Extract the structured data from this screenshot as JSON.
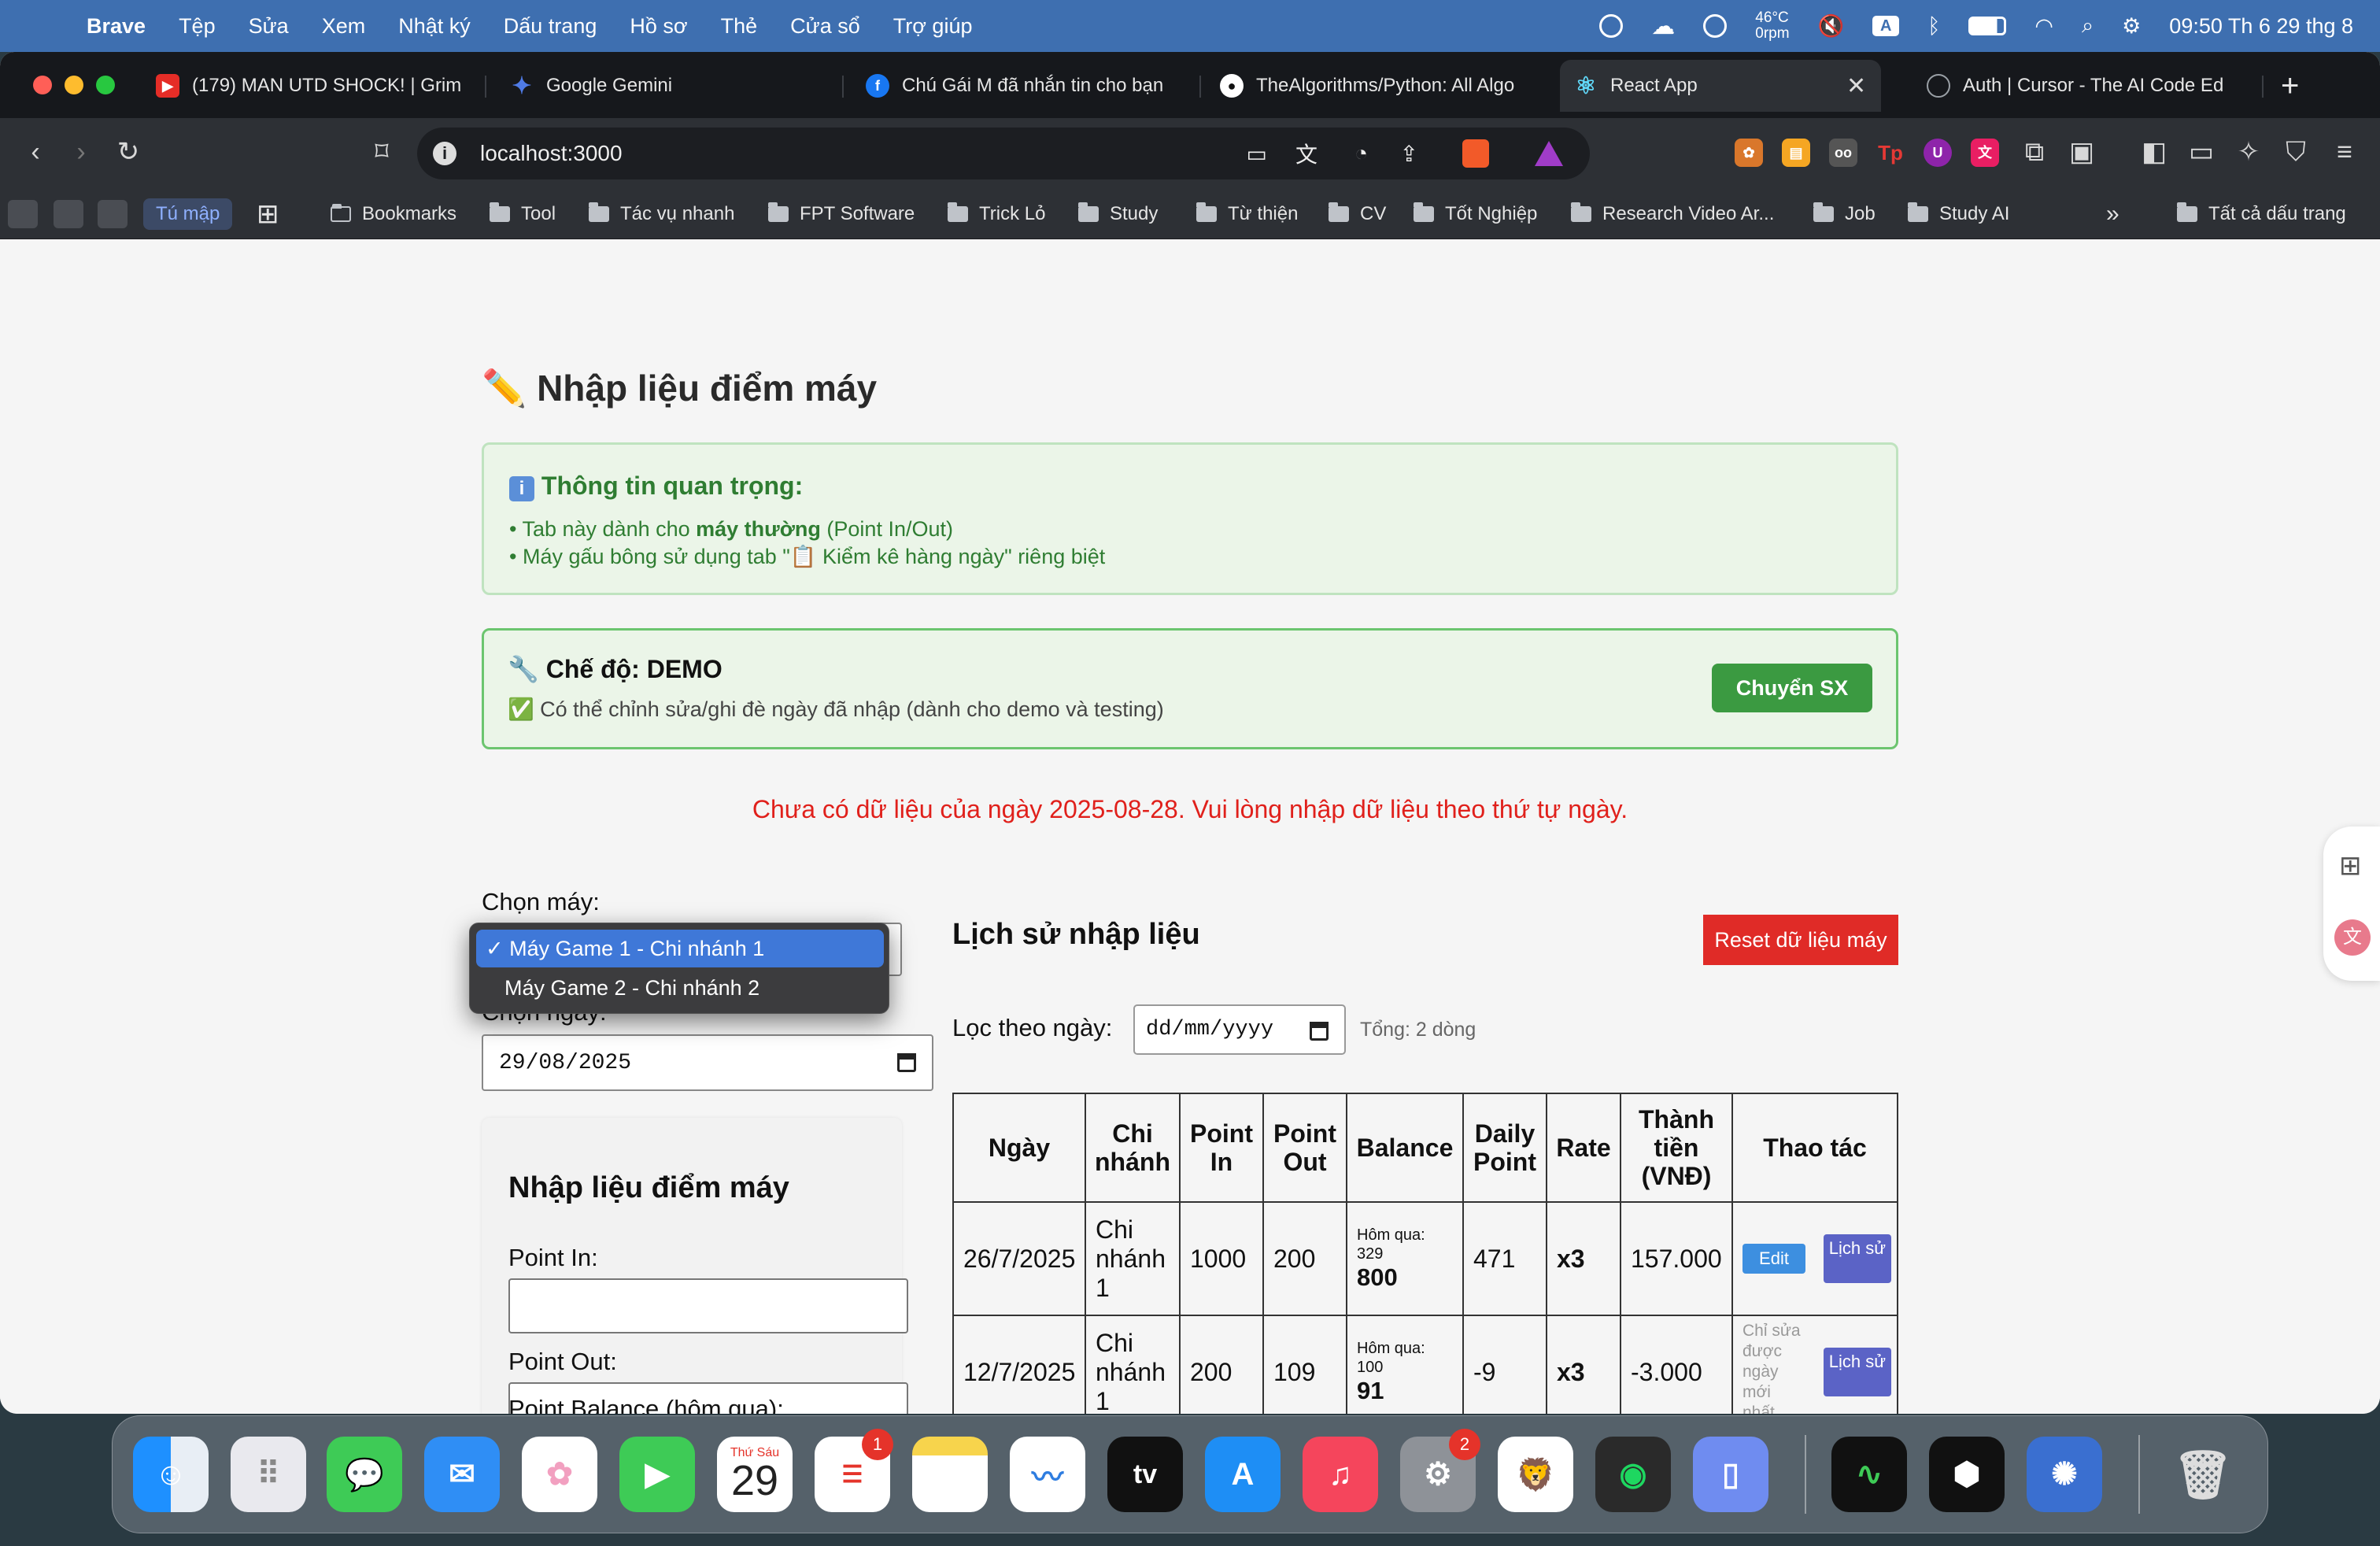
{
  "menubar": {
    "app": "Brave",
    "items": [
      "Tệp",
      "Sửa",
      "Xem",
      "Nhật ký",
      "Dấu trang",
      "Hồ sơ",
      "Thẻ",
      "Cửa sổ",
      "Trợ giúp"
    ],
    "temp": "46°C",
    "fan": "0rpm",
    "input_source": "A",
    "clock": "09:50 Th 6 29 thg 8"
  },
  "tabs": [
    {
      "title": "(179) MAN UTD SHOCK! | Grim",
      "icon": "youtube-icon",
      "color": "#e52d27"
    },
    {
      "title": "Google Gemini",
      "icon": "gemini-icon",
      "color": "#4f7be6"
    },
    {
      "title": "Chú Gái M đã nhắn tin cho bạn",
      "icon": "facebook-icon",
      "color": "#1877f2"
    },
    {
      "title": "TheAlgorithms/Python: All Algo",
      "icon": "github-icon",
      "color": "#ffffff"
    },
    {
      "title": "React App",
      "icon": "react-icon",
      "color": "#61dafb"
    },
    {
      "title": "Auth | Cursor - The AI Code Ed",
      "icon": "globe-icon",
      "color": "#9aa0a6"
    }
  ],
  "url": "localhost:3000",
  "bookmarks": {
    "tab_group": "Tú mập",
    "items": [
      "Bookmarks",
      "Tool",
      "Tác vụ nhanh",
      "FPT Software",
      "Trick Lỏ",
      "Study",
      "Từ thiện",
      "CV",
      "Tốt Nghiệp",
      "Research Video Ar...",
      "Job",
      "Study AI"
    ],
    "all": "Tất cả dấu trang"
  },
  "page": {
    "title": "Nhập liệu điểm máy",
    "info": {
      "heading": "Thông tin quan trọng:",
      "line1_pre": "• Tab này dành cho ",
      "line1_bold": "máy thường",
      "line1_post": " (Point In/Out)",
      "line2": "• Máy gấu bông sử dụng tab \"📋 Kiểm kê hàng ngày\" riêng biệt"
    },
    "mode": {
      "heading": "🔧 Chế độ: DEMO",
      "desc": "✅ Có thể chỉnh sửa/ghi đè ngày đã nhập (dành cho demo và testing)",
      "button": "Chuyển SX"
    },
    "notice": "Chưa có dữ liệu của ngày 2025-08-28. Vui lòng nhập dữ liệu theo thứ tự ngày.",
    "machine_label": "Chọn máy:",
    "machine_options": [
      "Máy Game 1 - Chi nhánh 1",
      "Máy Game 2 - Chi nhánh 2"
    ],
    "date_label": "Chọn ngày:",
    "date_value": "29/08/2025",
    "form": {
      "title": "Nhập liệu điểm máy",
      "point_in": "Point In:",
      "point_out": "Point Out:",
      "balance": "Point Balance (hôm qua):"
    },
    "history": {
      "title": "Lịch sử nhập liệu",
      "reset": "Reset dữ liệu máy",
      "filter_label": "Lọc theo ngày:",
      "filter_placeholder": "dd/mm/yyyy",
      "total": "Tổng: 2 dòng",
      "headers": [
        "Ngày",
        "Chi nhánh",
        "Point In",
        "Point Out",
        "Balance",
        "Daily Point",
        "Rate",
        "Thành tiền (VNĐ)",
        "Thao tác"
      ],
      "rows": [
        {
          "date": "26/7/2025",
          "branch": "Chi nhánh 1",
          "in": "1000",
          "out": "200",
          "bal_prev": "Hôm qua: 329",
          "bal": "800",
          "daily": "471",
          "rate": "x3",
          "amount": "157.000",
          "edit": "Edit",
          "hist": "Lịch sử"
        },
        {
          "date": "12/7/2025",
          "branch": "Chi nhánh 1",
          "in": "200",
          "out": "109",
          "bal_prev": "Hôm qua: 100",
          "bal": "91",
          "daily": "-9",
          "rate": "x3",
          "amount": "-3.000",
          "note": "Chỉ sửa được ngày mới nhất",
          "hist": "Lịch sử"
        }
      ]
    }
  },
  "dock": {
    "calendar_day": "Thứ Sáu",
    "calendar_date": "29",
    "reminders_badge": "1",
    "settings_badge": "2",
    "tv_label": "tv"
  }
}
